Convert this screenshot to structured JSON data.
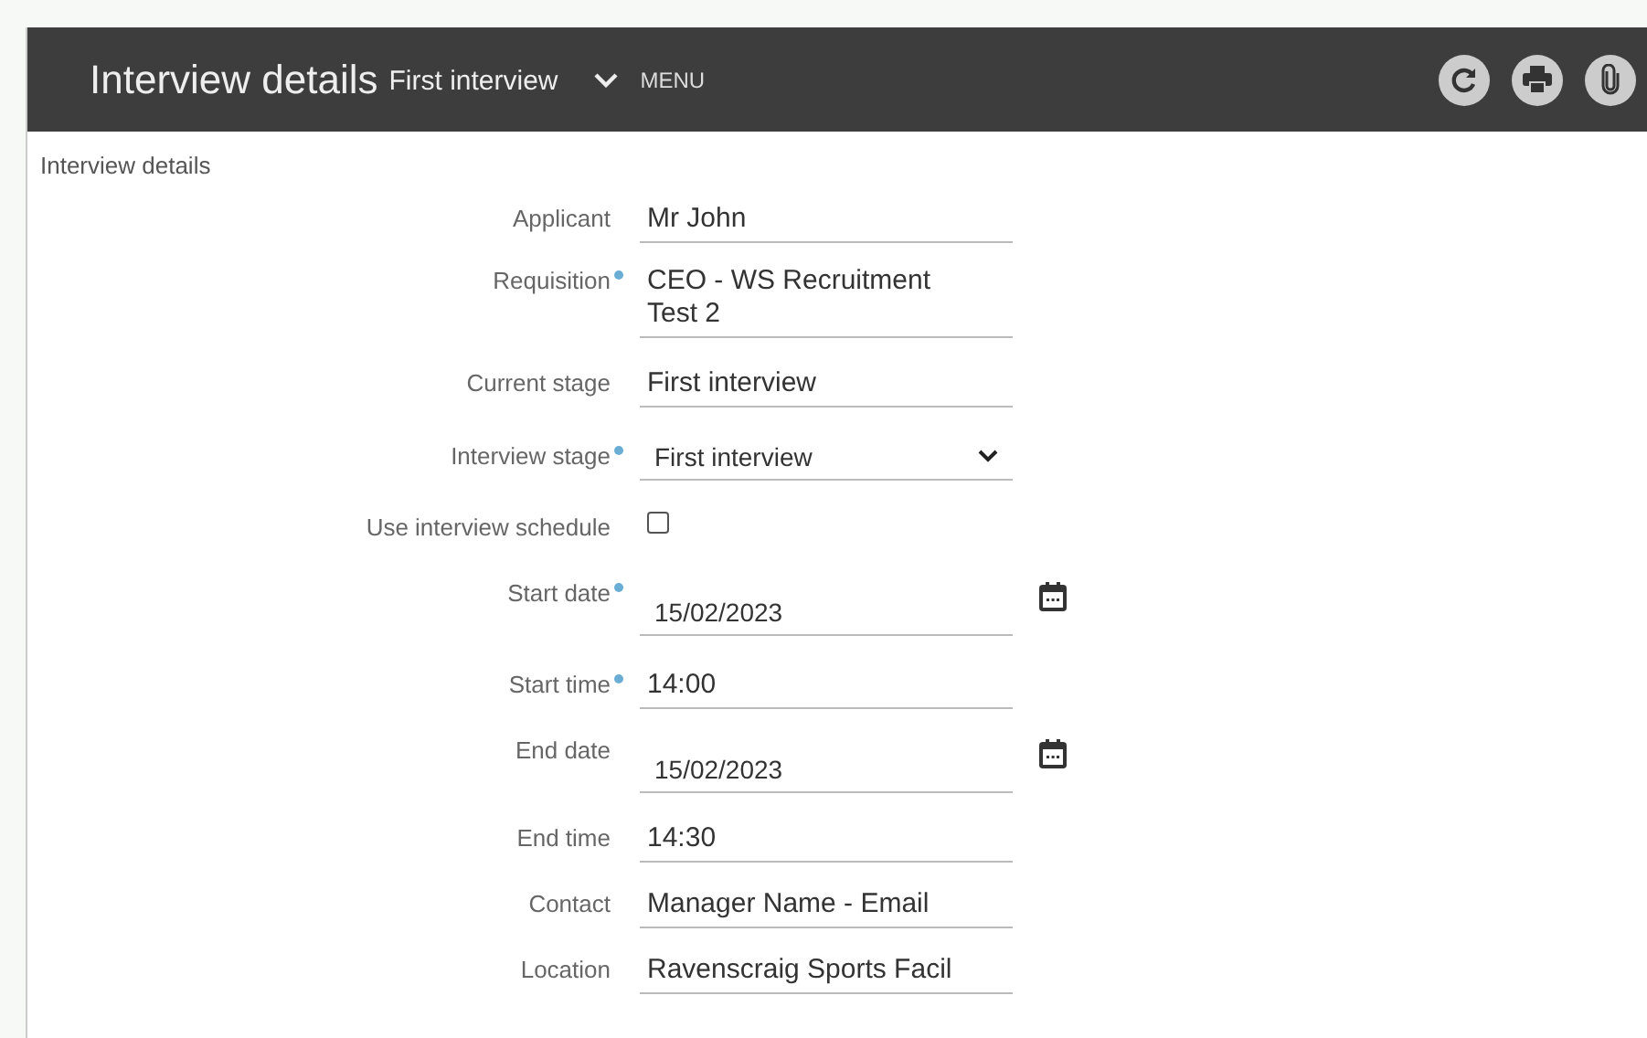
{
  "header": {
    "title": "Interview details",
    "subtitle": "First interview",
    "menu": "MENU"
  },
  "section": "Interview details",
  "fields": [
    {
      "label": "Applicant",
      "kind": "text",
      "required": false,
      "value": "Mr John"
    },
    {
      "label": "Requisition",
      "kind": "text",
      "required": true,
      "value": "CEO - WS Recruitment Test 2"
    },
    {
      "label": "Current stage",
      "kind": "text",
      "required": false,
      "value": "First interview"
    },
    {
      "label": "Interview stage",
      "kind": "select",
      "required": true,
      "value": "First interview"
    },
    {
      "label": "Use interview schedule",
      "kind": "checkbox",
      "required": false,
      "checked": false
    },
    {
      "label": "Start date",
      "kind": "date",
      "required": true,
      "value": "15/02/2023"
    },
    {
      "label": "Start time",
      "kind": "text",
      "required": true,
      "value": "14:00"
    },
    {
      "label": "End date",
      "kind": "date",
      "required": false,
      "value": "15/02/2023"
    },
    {
      "label": "End time",
      "kind": "text",
      "required": false,
      "value": "14:30"
    },
    {
      "label": "Contact",
      "kind": "text",
      "required": false,
      "value": "Manager Name - Email"
    },
    {
      "label": "Location",
      "kind": "text",
      "required": false,
      "value": "Ravenscraig Sports Facil"
    }
  ]
}
